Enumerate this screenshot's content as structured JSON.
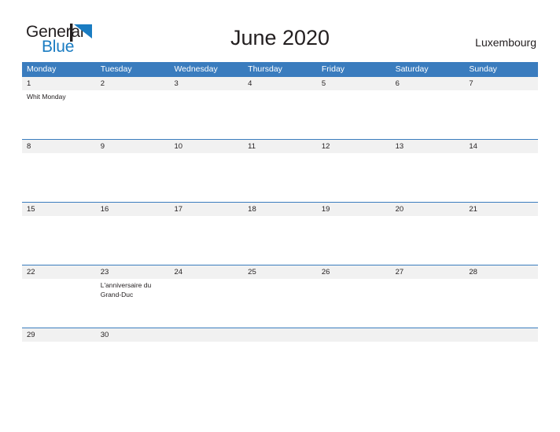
{
  "logo": {
    "text_primary": "General",
    "text_secondary": "Blue",
    "mark_icon": "blue-triangle-flag-icon",
    "primary_color": "#231f20",
    "secondary_color": "#1a7cc2"
  },
  "header": {
    "title": "June 2020",
    "country": "Luxembourg"
  },
  "theme": {
    "header_blue": "#3a7cbe",
    "date_band_gray": "#f1f1f1",
    "text_color": "#231f20",
    "white": "#ffffff"
  },
  "calendar": {
    "weekdays": [
      "Monday",
      "Tuesday",
      "Wednesday",
      "Thursday",
      "Friday",
      "Saturday",
      "Sunday"
    ],
    "weeks": [
      {
        "days": [
          {
            "date": "1",
            "events": [
              "Whit Monday"
            ]
          },
          {
            "date": "2",
            "events": []
          },
          {
            "date": "3",
            "events": []
          },
          {
            "date": "4",
            "events": []
          },
          {
            "date": "5",
            "events": []
          },
          {
            "date": "6",
            "events": []
          },
          {
            "date": "7",
            "events": []
          }
        ]
      },
      {
        "days": [
          {
            "date": "8",
            "events": []
          },
          {
            "date": "9",
            "events": []
          },
          {
            "date": "10",
            "events": []
          },
          {
            "date": "11",
            "events": []
          },
          {
            "date": "12",
            "events": []
          },
          {
            "date": "13",
            "events": []
          },
          {
            "date": "14",
            "events": []
          }
        ]
      },
      {
        "days": [
          {
            "date": "15",
            "events": []
          },
          {
            "date": "16",
            "events": []
          },
          {
            "date": "17",
            "events": []
          },
          {
            "date": "18",
            "events": []
          },
          {
            "date": "19",
            "events": []
          },
          {
            "date": "20",
            "events": []
          },
          {
            "date": "21",
            "events": []
          }
        ]
      },
      {
        "days": [
          {
            "date": "22",
            "events": []
          },
          {
            "date": "23",
            "events": [
              "L'anniversaire du Grand-Duc"
            ]
          },
          {
            "date": "24",
            "events": []
          },
          {
            "date": "25",
            "events": []
          },
          {
            "date": "26",
            "events": []
          },
          {
            "date": "27",
            "events": []
          },
          {
            "date": "28",
            "events": []
          }
        ]
      },
      {
        "days": [
          {
            "date": "29",
            "events": []
          },
          {
            "date": "30",
            "events": []
          },
          {
            "date": "",
            "events": []
          },
          {
            "date": "",
            "events": []
          },
          {
            "date": "",
            "events": []
          },
          {
            "date": "",
            "events": []
          },
          {
            "date": "",
            "events": []
          }
        ]
      }
    ]
  }
}
